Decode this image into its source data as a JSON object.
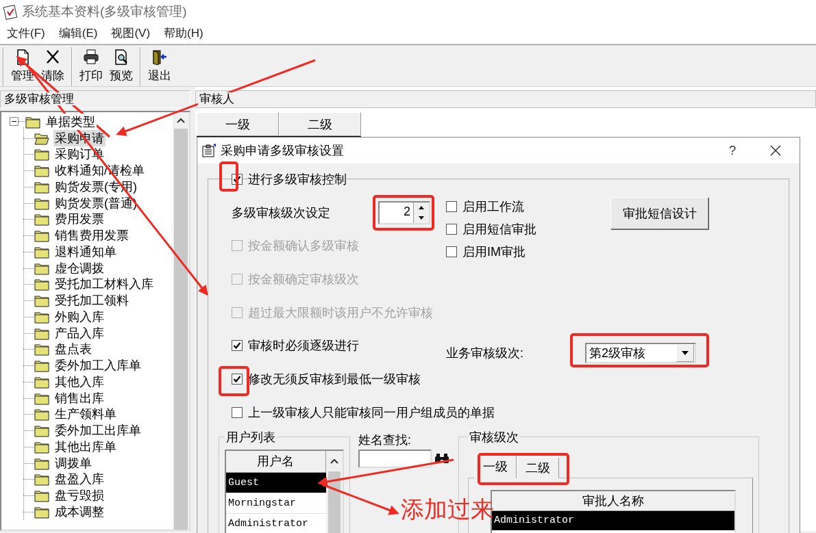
{
  "window": {
    "title": "系统基本资料(多级审核管理)"
  },
  "menu": [
    "文件(F)",
    "编辑(E)",
    "视图(V)",
    "帮助(H)"
  ],
  "toolbar": [
    {
      "buttons": [
        {
          "kind": "page",
          "label": "管理"
        },
        {
          "kind": "cross",
          "label": "清除"
        }
      ]
    },
    {
      "buttons": [
        {
          "kind": "printer",
          "label": "打印"
        },
        {
          "kind": "preview",
          "label": "预览"
        }
      ]
    },
    {
      "buttons": [
        {
          "kind": "exit",
          "label": "退出"
        }
      ]
    }
  ],
  "tree_panel": {
    "title": "多级审核管理",
    "root": {
      "label": "单据类型",
      "expanded": true,
      "children": [
        {
          "label": "采购申请",
          "selected": true
        },
        {
          "label": "采购订单",
          "selected": false
        },
        {
          "label": "收料通知/请检单",
          "selected": false
        },
        {
          "label": "购货发票(专用)",
          "selected": false
        },
        {
          "label": "购货发票(普通)",
          "selected": false
        },
        {
          "label": "费用发票",
          "selected": false
        },
        {
          "label": "销售费用发票",
          "selected": false
        },
        {
          "label": "退料通知单",
          "selected": false
        },
        {
          "label": "虚仓调拨",
          "selected": false
        },
        {
          "label": "受托加工材料入库",
          "selected": false
        },
        {
          "label": "受托加工领料",
          "selected": false
        },
        {
          "label": "外购入库",
          "selected": false
        },
        {
          "label": "产品入库",
          "selected": false
        },
        {
          "label": "盘点表",
          "selected": false
        },
        {
          "label": "委外加工入库单",
          "selected": false
        },
        {
          "label": "其他入库",
          "selected": false
        },
        {
          "label": "销售出库",
          "selected": false
        },
        {
          "label": "生产领料单",
          "selected": false
        },
        {
          "label": "委外加工出库单",
          "selected": false
        },
        {
          "label": "其他出库单",
          "selected": false
        },
        {
          "label": "调拨单",
          "selected": false
        },
        {
          "label": "盘盈入库",
          "selected": false
        },
        {
          "label": "盘亏毁损",
          "selected": false
        },
        {
          "label": "成本调整",
          "selected": false
        }
      ]
    }
  },
  "approver_panel": {
    "title": "审核人",
    "columns": [
      "一级",
      "二级"
    ]
  },
  "dialog": {
    "title": "采购申请多级审核设置",
    "help": "?",
    "options": [
      {
        "kind": "checkbox",
        "label": "进行多级审核控制",
        "checked": true,
        "disabled": false
      },
      {
        "kind": "spinner",
        "label": "多级审核级次设定",
        "value": "2"
      },
      {
        "kind": "checkbox",
        "label": "按金额确认多级审核",
        "checked": false,
        "disabled": true
      },
      {
        "kind": "checkbox",
        "label": "按金额确定审核级次",
        "checked": false,
        "disabled": true
      },
      {
        "kind": "checkbox",
        "label": "超过最大限额时该用户不允许审核",
        "checked": false,
        "disabled": true
      },
      {
        "kind": "checkbox",
        "label": "审核时必须逐级进行",
        "checked": true,
        "disabled": false
      },
      {
        "kind": "checkbox",
        "label": "修改无须反审核到最低一级审核",
        "checked": true,
        "disabled": false
      },
      {
        "kind": "checkbox",
        "label": "上一级审核人只能审核同一用户组成员的单据",
        "checked": false,
        "disabled": false
      }
    ],
    "integrations": [
      {
        "label": "启用工作流",
        "checked": false
      },
      {
        "label": "启用短信审批",
        "checked": false
      },
      {
        "label": "启用IM审批",
        "checked": false
      }
    ],
    "sms_button": "审批短信设计",
    "business_level": {
      "label": "业务审核级次:",
      "value": "第2级审核"
    },
    "user_list": {
      "title": "用户列表",
      "column": "用户名",
      "rows": [
        {
          "name": "Guest",
          "selected": true
        },
        {
          "name": "Morningstar",
          "selected": false
        },
        {
          "name": "Administrator",
          "selected": false
        }
      ]
    },
    "name_search": {
      "label": "姓名查找:"
    },
    "audit_levels": {
      "title": "审核级次",
      "tabs": [
        {
          "label": "一级",
          "selected": true
        },
        {
          "label": "二级",
          "selected": false
        }
      ],
      "column": "审批人名称",
      "rows": [
        {
          "name": "Administrator",
          "selected": true
        }
      ]
    }
  },
  "annotation": {
    "text": "添加过来"
  }
}
